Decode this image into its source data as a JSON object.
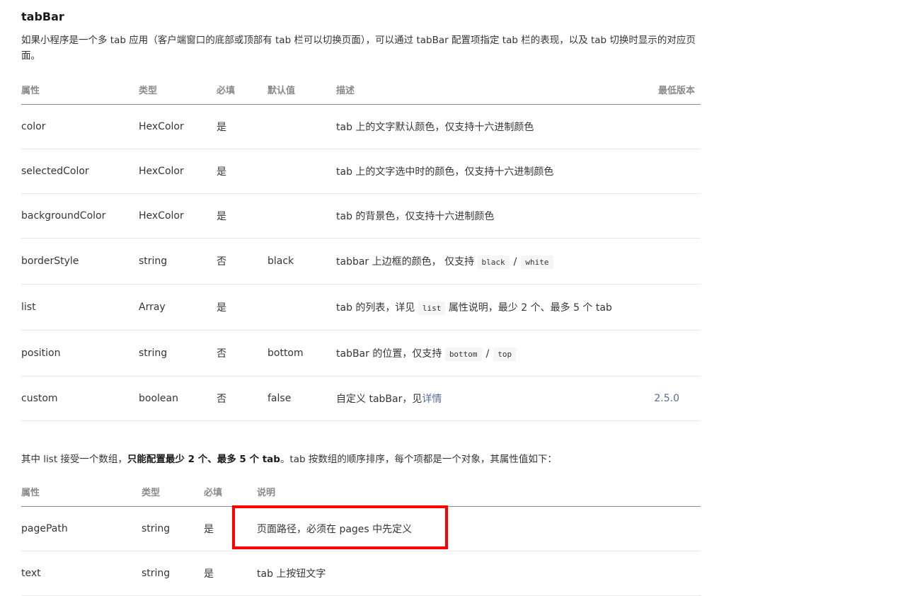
{
  "title": "tabBar",
  "intro": "如果小程序是一个多 tab 应用（客户端窗口的底部或顶部有 tab 栏可以切换页面），可以通过 tabBar 配置项指定 tab 栏的表现，以及 tab 切换时显示的对应页面。",
  "table1": {
    "headers": [
      "属性",
      "类型",
      "必填",
      "默认值",
      "描述",
      "最低版本"
    ],
    "rows": [
      {
        "name": "color",
        "type": "HexColor",
        "required": "是",
        "default": "",
        "desc": "tab 上的文字默认颜色，仅支持十六进制颜色",
        "version": ""
      },
      {
        "name": "selectedColor",
        "type": "HexColor",
        "required": "是",
        "default": "",
        "desc": "tab 上的文字选中时的颜色，仅支持十六进制颜色",
        "version": ""
      },
      {
        "name": "backgroundColor",
        "type": "HexColor",
        "required": "是",
        "default": "",
        "desc": "tab 的背景色，仅支持十六进制颜色",
        "version": ""
      },
      {
        "name": "borderStyle",
        "type": "string",
        "required": "否",
        "default": "black",
        "desc_pre": "tabbar 上边框的颜色， 仅支持",
        "code1": "black",
        "sep": "/",
        "code2": "white",
        "version": ""
      },
      {
        "name": "list",
        "type": "Array",
        "required": "是",
        "default": "",
        "desc_pre": "tab 的列表，详见",
        "code": "list",
        "desc_post": "属性说明，最少 2 个、最多 5 个 tab",
        "version": ""
      },
      {
        "name": "position",
        "type": "string",
        "required": "否",
        "default": "bottom",
        "desc_pre": "tabBar 的位置，仅支持",
        "code1": "bottom",
        "sep": "/",
        "code2": "top",
        "version": ""
      },
      {
        "name": "custom",
        "type": "boolean",
        "required": "否",
        "default": "false",
        "desc_pre": "自定义 tabBar，见",
        "link": "详情",
        "version": "2.5.0"
      }
    ]
  },
  "list_note": {
    "pre": "其中 list 接受一个数组，",
    "bold": "只能配置最少 2 个、最多 5 个 tab",
    "post": "。tab 按数组的顺序排序，每个项都是一个对象，其属性值如下："
  },
  "table2": {
    "headers": [
      "属性",
      "类型",
      "必填",
      "说明"
    ],
    "rows": [
      {
        "name": "pagePath",
        "type": "string",
        "required": "是",
        "desc": "页面路径，必须在 pages 中先定义"
      },
      {
        "name": "text",
        "type": "string",
        "required": "是",
        "desc": "tab 上按钮文字"
      }
    ]
  },
  "colors": {
    "highlight": "#ff0000",
    "link": "#576b95",
    "text": "#353535",
    "header": "#8a8a8a"
  }
}
